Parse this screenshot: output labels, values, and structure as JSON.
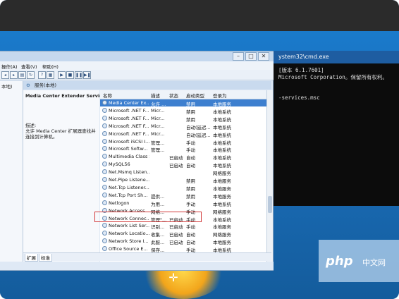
{
  "services_window": {
    "menu": [
      "操作(A)",
      "查看(V)",
      "帮助(H)"
    ],
    "left_label": "本地)",
    "panel_title": "服务(本地)",
    "detail": {
      "service_name": "Media Center Extender Service",
      "desc_label": "描述:",
      "desc_text": "允许 Media Center 扩展器查找并连接到计算机。"
    },
    "columns": [
      "名称",
      "描述",
      "状态",
      "启动类型",
      "登录为"
    ],
    "rows": [
      {
        "name": "Media Center Ex...",
        "desc": "允许 ...",
        "status": "",
        "startup": "禁用",
        "logon": "本地服务",
        "selected": true
      },
      {
        "name": "Microsoft .NET F...",
        "desc": "Micr...",
        "status": "",
        "startup": "禁用",
        "logon": "本地系统"
      },
      {
        "name": "Microsoft .NET F...",
        "desc": "Micr...",
        "status": "",
        "startup": "禁用",
        "logon": "本地系统"
      },
      {
        "name": "Microsoft .NET F...",
        "desc": "Micr...",
        "status": "",
        "startup": "自动(延迟...",
        "logon": "本地系统"
      },
      {
        "name": "Microsoft .NET F...",
        "desc": "Micr...",
        "status": "",
        "startup": "自动(延迟...",
        "logon": "本地系统"
      },
      {
        "name": "Microsoft iSCSI I...",
        "desc": "管理...",
        "status": "",
        "startup": "手动",
        "logon": "本地系统"
      },
      {
        "name": "Microsoft Softw...",
        "desc": "管理...",
        "status": "",
        "startup": "手动",
        "logon": "本地系统"
      },
      {
        "name": "Multimedia Class Scheduler",
        "desc": "",
        "status": "已启动",
        "startup": "自动",
        "logon": "本地系统"
      },
      {
        "name": "MySQL56",
        "desc": "",
        "status": "已启动",
        "startup": "自动",
        "logon": "本地系统"
      },
      {
        "name": "Net.Msmq Listen...",
        "desc": "",
        "status": "",
        "startup": "",
        "logon": "网络服务"
      },
      {
        "name": "Net.Pipe Listene...",
        "desc": "",
        "status": "",
        "startup": "禁用",
        "logon": "本地服务"
      },
      {
        "name": "Net.Tcp Listener...",
        "desc": "",
        "status": "",
        "startup": "禁用",
        "logon": "本地服务"
      },
      {
        "name": "Net.Tcp Port Sh...",
        "desc": "提供...",
        "status": "",
        "startup": "禁用",
        "logon": "本地服务"
      },
      {
        "name": "Netlogon",
        "desc": "为用...",
        "status": "",
        "startup": "手动",
        "logon": "本地系统"
      },
      {
        "name": "Network Access ...",
        "desc": "网络...",
        "status": "",
        "startup": "手动",
        "logon": "网络服务"
      },
      {
        "name": "Network Connec...",
        "desc": "管理\"...",
        "status": "已启动",
        "startup": "手动",
        "logon": "本地系统"
      },
      {
        "name": "Network List Ser...",
        "desc": "识别...",
        "status": "已启动",
        "startup": "手动",
        "logon": "本地服务"
      },
      {
        "name": "Network Locatio...",
        "desc": "收集...",
        "status": "已启动",
        "startup": "自动",
        "logon": "网络服务"
      },
      {
        "name": "Network Store I...",
        "desc": "此服...",
        "status": "已启动",
        "startup": "自动",
        "logon": "本地服务"
      },
      {
        "name": "Office  Source E...",
        "desc": "保存...",
        "status": "",
        "startup": "手动",
        "logon": "本地系统"
      }
    ],
    "tabs": [
      "扩展",
      "标准"
    ]
  },
  "cmd_window": {
    "title": "ystem32\\cmd.exe",
    "lines": [
      "[版本 6.1.7601]",
      "Microsoft Corporation。保留所有权利。",
      "",
      "-services.msc"
    ]
  },
  "watermark": {
    "logo": "php",
    "text": "中文网"
  },
  "colors": {
    "selection": "#3d7fcf",
    "highlight_border": "#d23a3a",
    "desktop": "#1a7acb"
  }
}
